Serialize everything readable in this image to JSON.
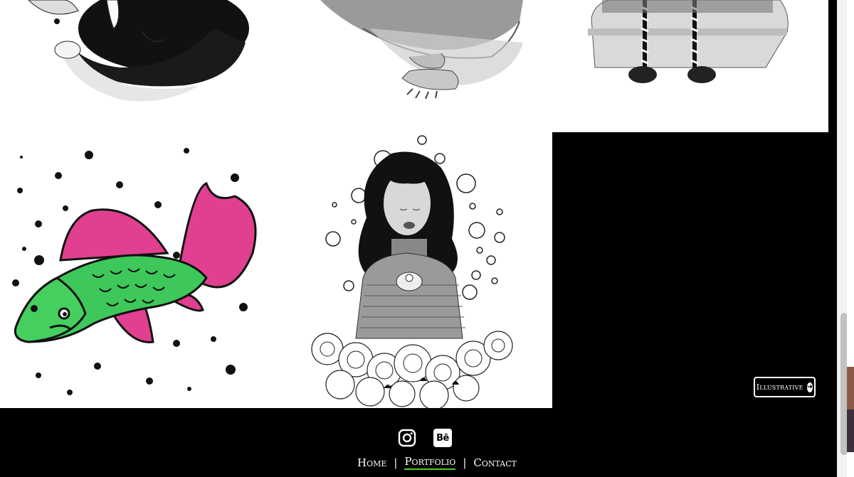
{
  "gallery": {
    "items": [
      {
        "id": "fox",
        "icon": "fox-illustration"
      },
      {
        "id": "rodent",
        "icon": "rodent-illustration"
      },
      {
        "id": "zebra",
        "icon": "zebra-illustration"
      },
      {
        "id": "fish",
        "icon": "fish-illustration"
      },
      {
        "id": "girl",
        "icon": "girl-with-cat-illustration"
      }
    ],
    "category_button": {
      "label": "Illustrative",
      "icon": "arrow-right-circle-icon"
    }
  },
  "footer": {
    "social": [
      {
        "name": "Instagram",
        "icon": "instagram-icon"
      },
      {
        "name": "Behance",
        "icon": "behance-icon",
        "glyph": "Bē"
      }
    ],
    "nav": [
      {
        "label": "Home",
        "active": false
      },
      {
        "label": "Portfolio",
        "active": true
      },
      {
        "label": "Contact",
        "active": false
      }
    ],
    "separator": "|"
  },
  "colors": {
    "background": "#000000",
    "accent_underline": "#4ccc2e",
    "fish_green": "#3ec75a",
    "fish_pink": "#e0408f"
  }
}
